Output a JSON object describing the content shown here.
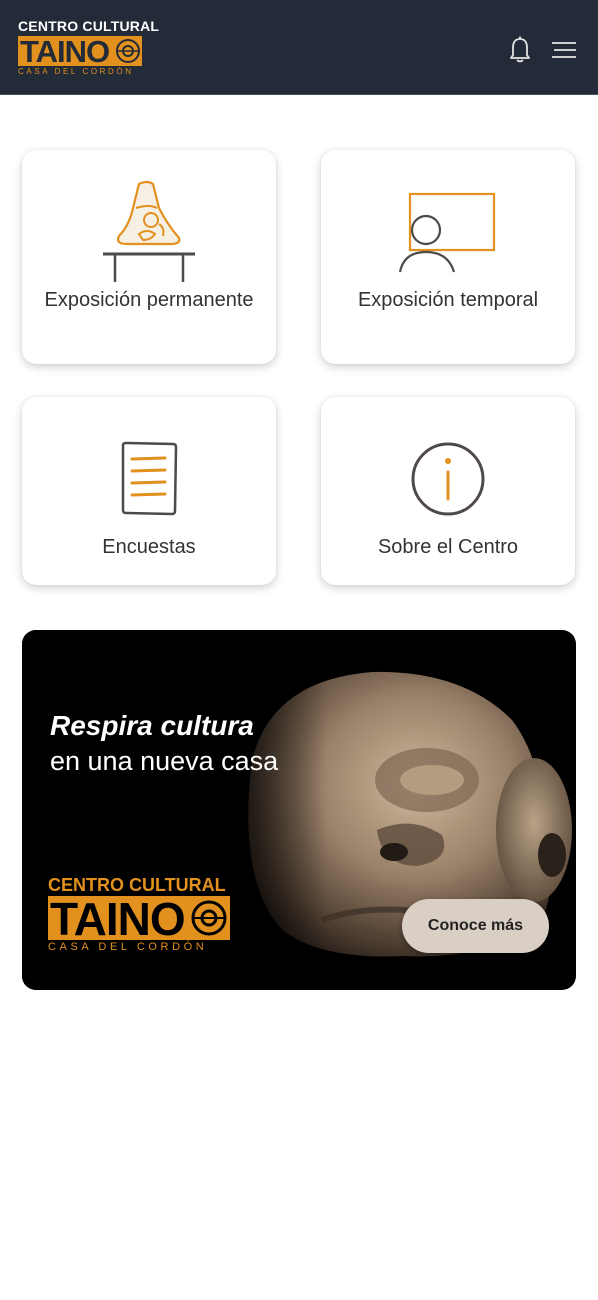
{
  "header": {
    "logo_line1": "CENTRO CULTURAL",
    "logo_main": "TAINO",
    "logo_line3": "CASA DEL CORDÓN",
    "notification_icon": "bell-icon",
    "menu_icon": "hamburger-menu-icon"
  },
  "cards": [
    {
      "label": "Exposición permanente",
      "icon": "artifact-pedestal-icon"
    },
    {
      "label": "Exposición temporal",
      "icon": "presentation-screen-icon"
    },
    {
      "label": "Encuestas",
      "icon": "document-list-icon"
    },
    {
      "label": "Sobre el Centro",
      "icon": "info-circle-icon"
    }
  ],
  "banner": {
    "title": "Respira cultura",
    "subtitle": "en una nueva casa",
    "logo_line1": "CENTRO CULTURAL",
    "logo_main": "TAINO",
    "logo_line3": "CASA DEL CORDÓN",
    "cta_label": "Conoce más"
  },
  "colors": {
    "header_bg": "#232b38",
    "accent_orange": "#e2901e",
    "icon_dark": "#4f4a48",
    "banner_bg": "#000000",
    "cta_bg": "#d9cfc4"
  }
}
